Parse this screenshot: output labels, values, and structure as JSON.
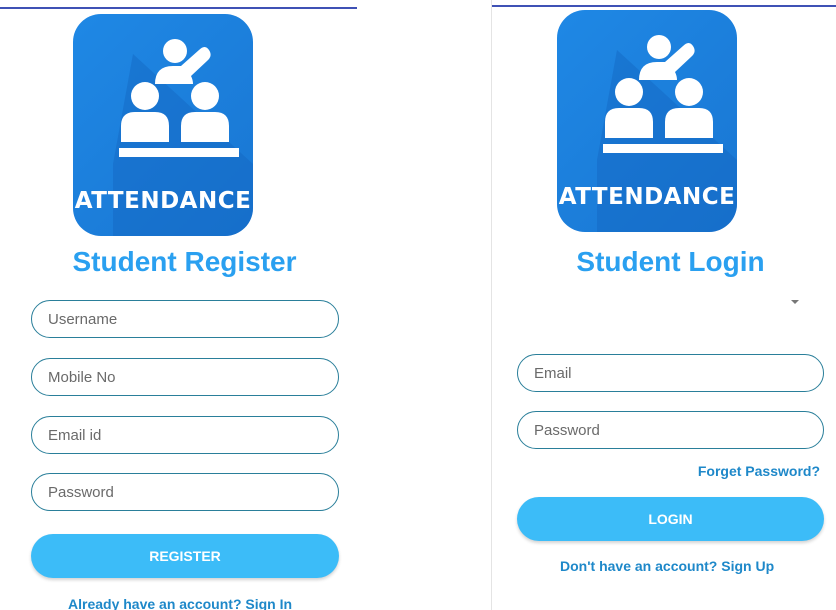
{
  "register": {
    "logo_text": "ATTENDANCE",
    "title": "Student Register",
    "fields": [
      {
        "placeholder": "Username"
      },
      {
        "placeholder": "Mobile No"
      },
      {
        "placeholder": "Email id"
      },
      {
        "placeholder": "Password"
      }
    ],
    "button_label": "REGISTER",
    "signin_link": "Already have an account? Sign In"
  },
  "login": {
    "logo_text": "ATTENDANCE",
    "title": "Student Login",
    "fields": [
      {
        "placeholder": "Email"
      },
      {
        "placeholder": "Password"
      }
    ],
    "forgot_link": "Forget Password?",
    "button_label": "LOGIN",
    "signup_link": "Don't have an account? Sign Up",
    "dropdown_icon": "caret-down-icon"
  },
  "colors": {
    "logo_bg": "#1f88e5",
    "title": "#2aa0f0",
    "button": "#3cbcf8",
    "link": "#1e88c9",
    "field_border": "#2a7f9a",
    "top_bar": "#3f51b5"
  }
}
